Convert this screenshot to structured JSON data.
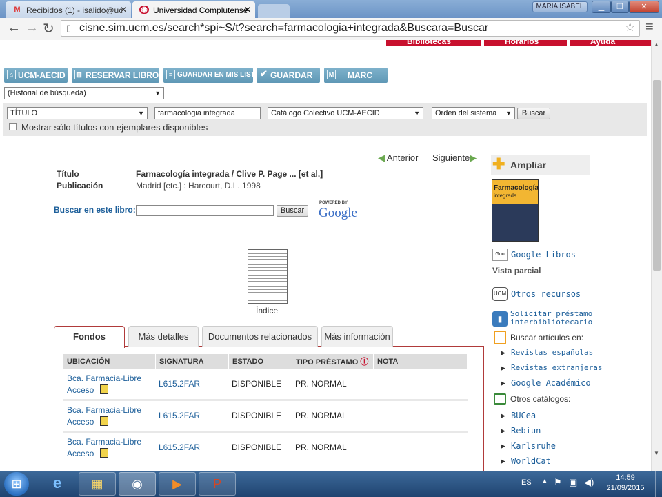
{
  "browser": {
    "tabs": [
      {
        "label": "Recibidos (1) - isalido@uc",
        "icon": "gmail-icon",
        "close": "✕"
      },
      {
        "label": "Universidad Complutense",
        "icon": "ucm-icon",
        "close": "✕"
      }
    ],
    "user": "MARIA ISABEL",
    "url": "cisne.sim.ucm.es/search*spi~S/t?search=farmacologia+integrada&Buscara=Buscar"
  },
  "top_nav": [
    "Bibliotecas",
    "Horarios",
    "Ayuda"
  ],
  "toolbar": [
    "UCM-AECID",
    "RESERVAR LIBROS",
    "GUARDAR EN MIS LISTAS",
    "GUARDAR",
    "MARC"
  ],
  "search": {
    "history": "(Historial de búsqueda)",
    "field": "TÍTULO",
    "query": "farmacologia integrada",
    "catalog": "Catálogo Colectivo UCM-AECID",
    "order": "Orden del sistema",
    "button": "Buscar",
    "only_available": "Mostrar sólo títulos con ejemplares disponibles"
  },
  "record_nav": {
    "prev": "Anterior",
    "next": "Siguiente"
  },
  "record": {
    "title_label": "Título",
    "title": "Farmacología integrada / Clive P. Page ... [et al.]",
    "pub_label": "Publicación",
    "pub": "Madrid [etc.] : Harcourt, D.L. 1998"
  },
  "book_search": {
    "label": "Buscar en este libro:",
    "button": "Buscar",
    "powered": "POWERED BY",
    "brand": "Google"
  },
  "index_label": "Índice",
  "detail_tabs": [
    "Fondos",
    "Más detalles",
    "Documentos relacionados",
    "Más información"
  ],
  "holdings": {
    "columns": [
      "UBICACIÓN",
      "SIGNATURA",
      "ESTADO",
      "TIPO PRÉSTAMO",
      "NOTA"
    ],
    "rows": [
      {
        "ubicacion_1": "Bca. Farmacia-Libre",
        "ubicacion_2": "Acceso",
        "signatura": "L615.2FAR",
        "estado": "DISPONIBLE",
        "tipo": "PR. NORMAL",
        "nota": ""
      },
      {
        "ubicacion_1": "Bca. Farmacia-Libre",
        "ubicacion_2": "Acceso",
        "signatura": "L615.2FAR",
        "estado": "DISPONIBLE",
        "tipo": "PR. NORMAL",
        "nota": ""
      },
      {
        "ubicacion_1": "Bca. Farmacia-Libre",
        "ubicacion_2": "Acceso",
        "signatura": "L615.2FAR",
        "estado": "DISPONIBLE",
        "tipo": "PR. NORMAL",
        "nota": ""
      }
    ]
  },
  "sidebar": {
    "ampliar": "Ampliar",
    "cover_title": "Farmacología",
    "cover_sub": "integrada",
    "google_books": "Google Libros",
    "vista_parcial": "Vista parcial",
    "otros_recursos": "Otros recursos",
    "solicitar_1": "Solicitar préstamo",
    "solicitar_2": "interbibliotecario",
    "buscar_articulos": "Buscar artículos en:",
    "articulos": [
      "Revistas españolas",
      "Revistas extranjeras",
      "Google Académico"
    ],
    "otros_catalogos": "Otros catálogos:",
    "catalogos": [
      "BUCea",
      "Rebiun",
      "Karlsruhe",
      "WorldCat"
    ]
  },
  "taskbar": {
    "lang": "ES",
    "time": "14:59",
    "date": "21/09/2015"
  }
}
